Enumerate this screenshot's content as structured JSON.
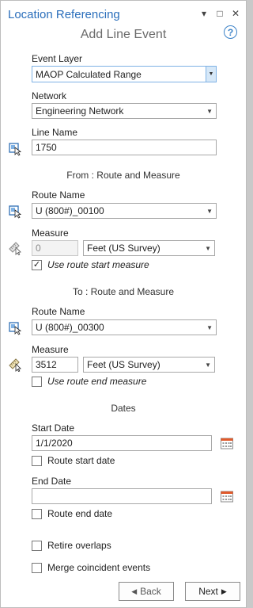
{
  "window": {
    "title": "Location Referencing",
    "subtitle": "Add Line Event",
    "controls": {
      "menu": "▾",
      "maximize": "□",
      "close": "✕"
    },
    "help": "?"
  },
  "event_layer": {
    "label": "Event Layer",
    "value": "MAOP Calculated Range"
  },
  "network": {
    "label": "Network",
    "value": "Engineering Network"
  },
  "line_name": {
    "label": "Line Name",
    "value": "1750"
  },
  "from": {
    "heading": "From : Route and Measure",
    "route_label": "Route Name",
    "route_value": "U (800#)_00100",
    "measure_label": "Measure",
    "measure_value": "0",
    "units": "Feet (US Survey)",
    "use_measure_label": "Use route start measure",
    "use_measure_checked": true
  },
  "to": {
    "heading": "To : Route and Measure",
    "route_label": "Route Name",
    "route_value": "U (800#)_00300",
    "measure_label": "Measure",
    "measure_value": "3512",
    "units": "Feet (US Survey)",
    "use_measure_label": "Use route end measure",
    "use_measure_checked": false
  },
  "dates": {
    "heading": "Dates",
    "start_label": "Start Date",
    "start_value": "1/1/2020",
    "route_start_label": "Route start date",
    "end_label": "End Date",
    "end_value": "",
    "route_end_label": "Route end date"
  },
  "options": {
    "retire_overlaps": "Retire overlaps",
    "merge_coincident": "Merge coincident events"
  },
  "nav": {
    "back": "Back",
    "next": "Next"
  },
  "colors": {
    "accent": "#2a6ebb",
    "dropdown_border": "#7fb2e5"
  },
  "icons": {
    "check": "✓",
    "caret": "▼",
    "back_arrow": "◀",
    "next_arrow": "▶"
  }
}
